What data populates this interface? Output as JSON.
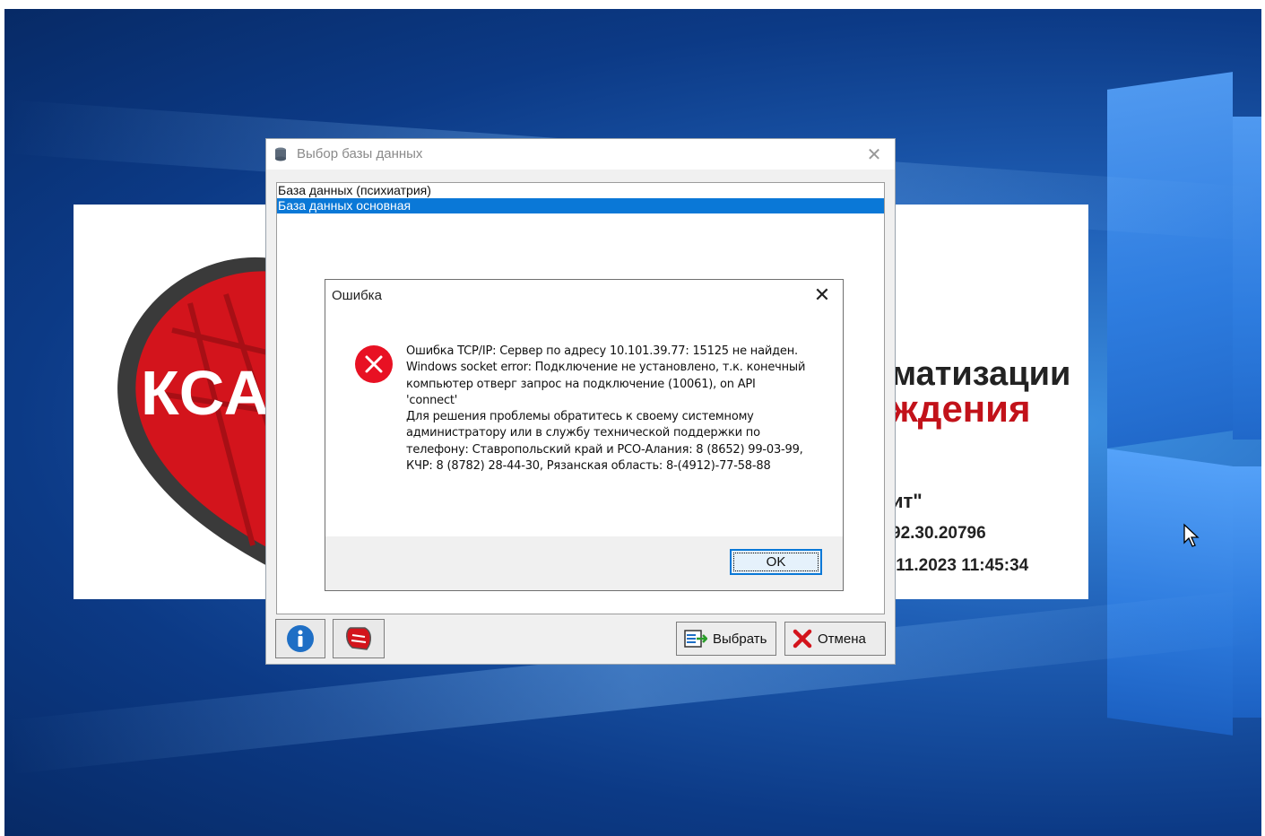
{
  "splash": {
    "logo_text": "КСА",
    "title_line1": "матизации",
    "title_line2": "ждения",
    "company_fragment": "ит\"",
    "version_fragment": "92.30.20796",
    "date_fragment": ".11.2023 11:45:34",
    "brand_color": "#c2121a"
  },
  "db_dialog": {
    "title": "Выбор базы данных",
    "close_glyph": "✕",
    "items": [
      {
        "label": "База данных (психиатрия)",
        "selected": false
      },
      {
        "label": "База данных основная",
        "selected": true
      }
    ],
    "toolbar": {
      "info_icon": "info-icon",
      "app_icon": "app-logo-icon"
    },
    "select_button": "Выбрать",
    "cancel_button": "Отмена",
    "selection_color": "#0a78d7"
  },
  "error_dialog": {
    "title": "Ошибка",
    "close_glyph": "✕",
    "icon": "error-icon",
    "message": "Ошибка TCP/IP: Сервер по адресу 10.101.39.77: 15125 не найден.\nWindows socket error: Подключение не установлено, т.к. конечный компьютер отверг запрос на подключение (10061), on API 'connect'\nДля решения проблемы обратитесь к своему системному администратору или в службу технической поддержки по телефону: Ставропольский край и РСО-Алания: 8 (8652) 99-03-99, КЧР: 8 (8782) 28-44-30, Рязанская область: 8-(4912)-77-58-88",
    "ok_button": "OK",
    "error_color": "#e81123"
  }
}
